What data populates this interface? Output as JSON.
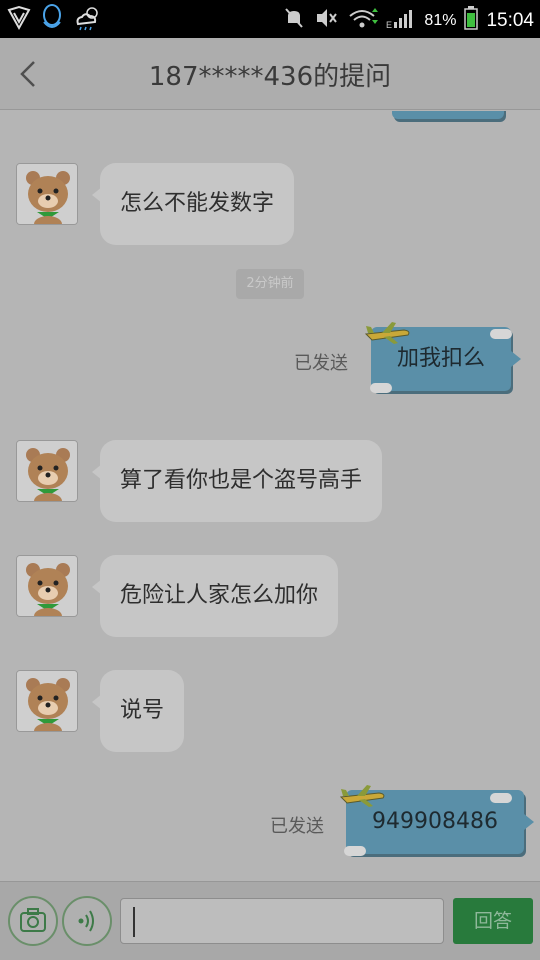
{
  "status_bar": {
    "battery_percent": "81%",
    "time": "15:04",
    "network": "E"
  },
  "header": {
    "title": "187*****436的提问"
  },
  "chat": {
    "timestamp": "2分钟前",
    "messages": [
      {
        "direction": "in",
        "text": "怎么不能发数字"
      },
      {
        "direction": "out",
        "text": "加我扣么",
        "status": "已发送"
      },
      {
        "direction": "in",
        "text": "算了看你也是个盗号高手"
      },
      {
        "direction": "in",
        "text": "危险让人家怎么加你"
      },
      {
        "direction": "in",
        "text": "说号"
      },
      {
        "direction": "out",
        "text": "949908486",
        "status": "已发送"
      }
    ]
  },
  "composer": {
    "reply_label": "回答",
    "input_value": ""
  },
  "colors": {
    "outgoing_bubble": "#5a8fa8",
    "reply_button": "#287a3c"
  }
}
